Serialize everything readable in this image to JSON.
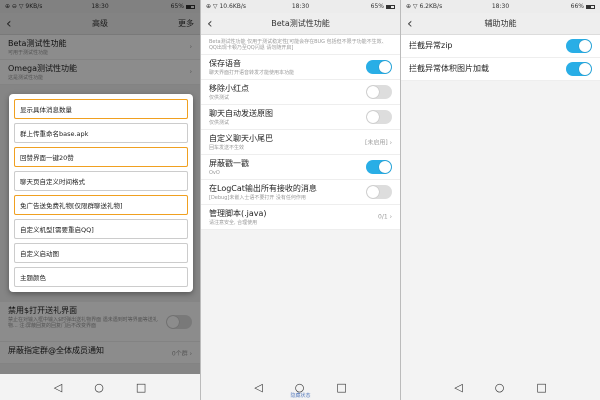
{
  "status": {
    "left1": "⊕ ⊖ ▽ 9KB/s",
    "left2": "⊕ ▽ 10.6KB/s",
    "left3": "⊕ ▽ 6.2KB/s",
    "time": "18:30",
    "battery1": "65%",
    "battery2": "65%",
    "battery3": "66%"
  },
  "screen1": {
    "title": "高级",
    "more": "更多",
    "rows": [
      {
        "title": "Beta测试性功能",
        "sub": "可用于测试性功能"
      },
      {
        "title": "Omega测试性功能",
        "sub": "这是测试性功能"
      }
    ],
    "options": [
      {
        "label": "显示具体消息数量",
        "selected": true
      },
      {
        "label": "群上传重命名base.apk",
        "selected": false
      },
      {
        "label": "回赞界面一键20赞",
        "selected": true
      },
      {
        "label": "聊天页自定义时间格式",
        "selected": false
      },
      {
        "label": "免广告送免费礼物[仅限群聊送礼物]",
        "selected": true
      },
      {
        "label": "自定义机型[需要重启QQ]",
        "selected": false
      },
      {
        "label": "自定义启动图",
        "selected": false
      },
      {
        "label": "主题颜色",
        "selected": false
      }
    ],
    "bottom_rows": [
      {
        "title": "禁用$打开送礼界面",
        "sub": "禁止在对输入框中输入$时弹出送礼物界面 遇未遇到时等界面等送礼物... 注:屏蔽回复的回复门后不改变界面"
      },
      {
        "title": "屏蔽指定群@全体成员通知",
        "right": "0个群 ›"
      }
    ]
  },
  "screen2": {
    "title": "Beta测试性功能",
    "intro": "Beta测试性功能 仅用于测试稳定性[可能会存在BUG 包括但不限于功能不生效、QQ出现卡顿乃至QQ闪退 请勿随开启]",
    "rows": [
      {
        "title": "保存语音",
        "sub": "聊天界面打开语音转发才能使用本功能",
        "switch": "on"
      },
      {
        "title": "移除小红点",
        "sub": "仅供测试",
        "switch": "off"
      },
      {
        "title": "聊天自动发送原图",
        "sub": "仅供测试",
        "switch": "off"
      },
      {
        "title": "自定义聊天小尾巴",
        "sub": "回车发送不生效",
        "right": "[未启用] ›"
      },
      {
        "title": "屏蔽戳一戳",
        "sub": "OvO",
        "switch": "on"
      },
      {
        "title": "在LogCat输出所有接收的消息",
        "sub": "[Debug]未嵌入士语不要打开 没有任何作用",
        "switch": "off"
      },
      {
        "title": "管理脚本(.java)",
        "sub": "请注意安全, 合理使用",
        "right": "0/1 ›"
      }
    ],
    "nav_tip": "隐藏状态"
  },
  "screen3": {
    "title": "辅助功能",
    "rows": [
      {
        "title": "拦截异常zip",
        "switch": "on"
      },
      {
        "title": "拦截异常体积图片加载",
        "switch": "on"
      }
    ]
  },
  "nav": {
    "back": "◁",
    "home": "○",
    "recent": "□"
  }
}
